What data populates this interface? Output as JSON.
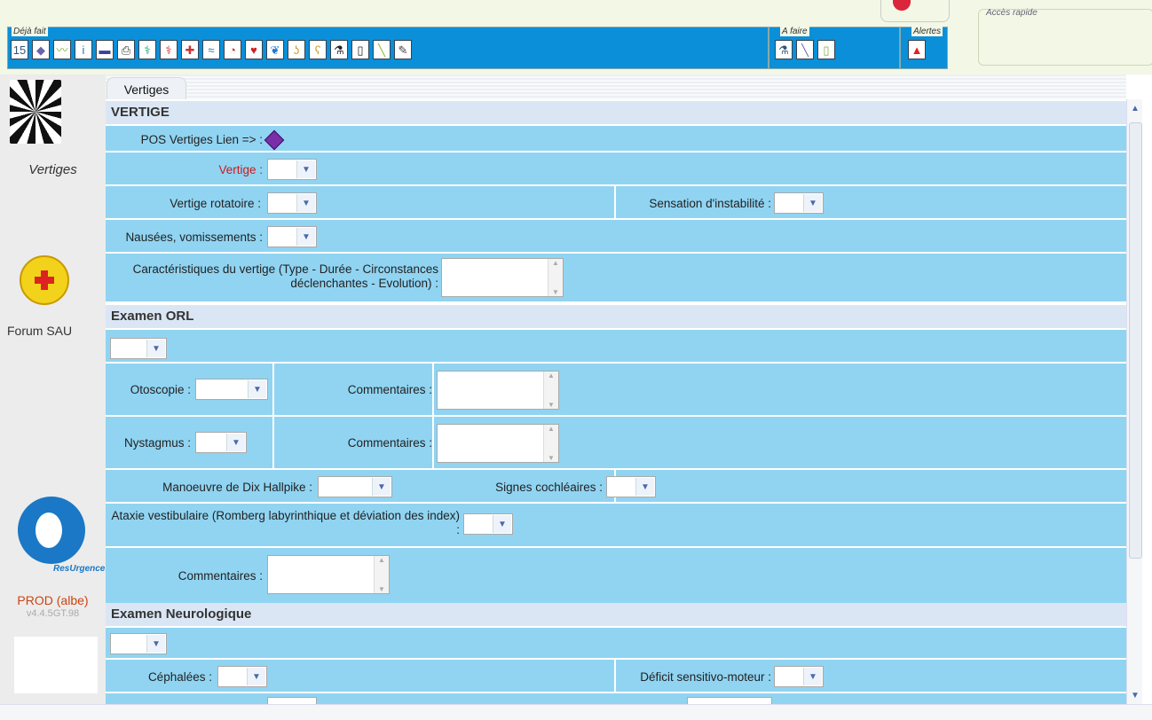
{
  "toolbar": {
    "deja_fait_label": "Déjà fait",
    "a_faire_label": "A faire",
    "alertes_label": "Alertes",
    "acces_rapide_label": "Accès rapide",
    "deja_fait_icons": [
      "calendar-15-icon",
      "book-icon",
      "chart-icon",
      "person-info-icon",
      "notebook-icon",
      "printer-icon",
      "caduceus-icon",
      "caduceus-alt-icon",
      "hospital-icon",
      "ecg-icon",
      "head-icon",
      "heart-icon",
      "lungs-icon",
      "stomach-icon",
      "bone-icon",
      "microscope-icon",
      "clipboard-icon",
      "syringe-icon",
      "pen-icon"
    ],
    "deja_fait_glyphs": [
      "15",
      "◆",
      "〰",
      "i",
      "▬",
      "⎙",
      "⚕",
      "⚕",
      "✚",
      "≈",
      "◔",
      "♥",
      "❦",
      "ʖ",
      "ʕ",
      "⚗",
      "▯",
      "╲",
      "✎"
    ],
    "a_faire_icons": [
      "microscope-icon",
      "syringe-icon",
      "clipboard-icon"
    ],
    "a_faire_glyphs": [
      "⚗",
      "╲",
      "▯"
    ],
    "alert_icon": "warning-icon",
    "alert_glyph": "▲"
  },
  "sidebar": {
    "title": "Vertiges",
    "forum": "Forum SAU",
    "logo_text": "ResUrgences",
    "env": "PROD (albe)",
    "version": "v4.4.5GT.98"
  },
  "tab": {
    "label": "Vertiges"
  },
  "sections": {
    "vertige": {
      "title": "VERTIGE",
      "pos_link_label": "POS Vertiges Lien => :",
      "vertige_label": "Vertige :",
      "rotatoire_label": "Vertige rotatoire :",
      "instabilite_label": "Sensation d'instabilité :",
      "nausees_label": "Nausées, vomissements :",
      "caract_label": "Caractéristiques du vertige (Type - Durée - Circonstances déclenchantes - Evolution) :"
    },
    "orl": {
      "title": "Examen ORL",
      "otoscopie_label": "Otoscopie :",
      "commentaires_label": "Commentaires :",
      "nystagmus_label": "Nystagmus :",
      "dix_label": "Manoeuvre de Dix Hallpike :",
      "cochleaires_label": "Signes cochléaires :",
      "ataxie_label": "Ataxie vestibulaire (Romberg labyrinthique et déviation des index) :"
    },
    "neuro": {
      "title": "Examen Neurologique",
      "cephalees_label": "Céphalées :",
      "deficit_label": "Déficit sensitivo-moteur :"
    }
  },
  "colors": {
    "row_bg": "#90d4f2",
    "toolbar_blue": "#0a8fd8",
    "section_bg": "#dbe6f4",
    "required_red": "#cc1a1a"
  }
}
